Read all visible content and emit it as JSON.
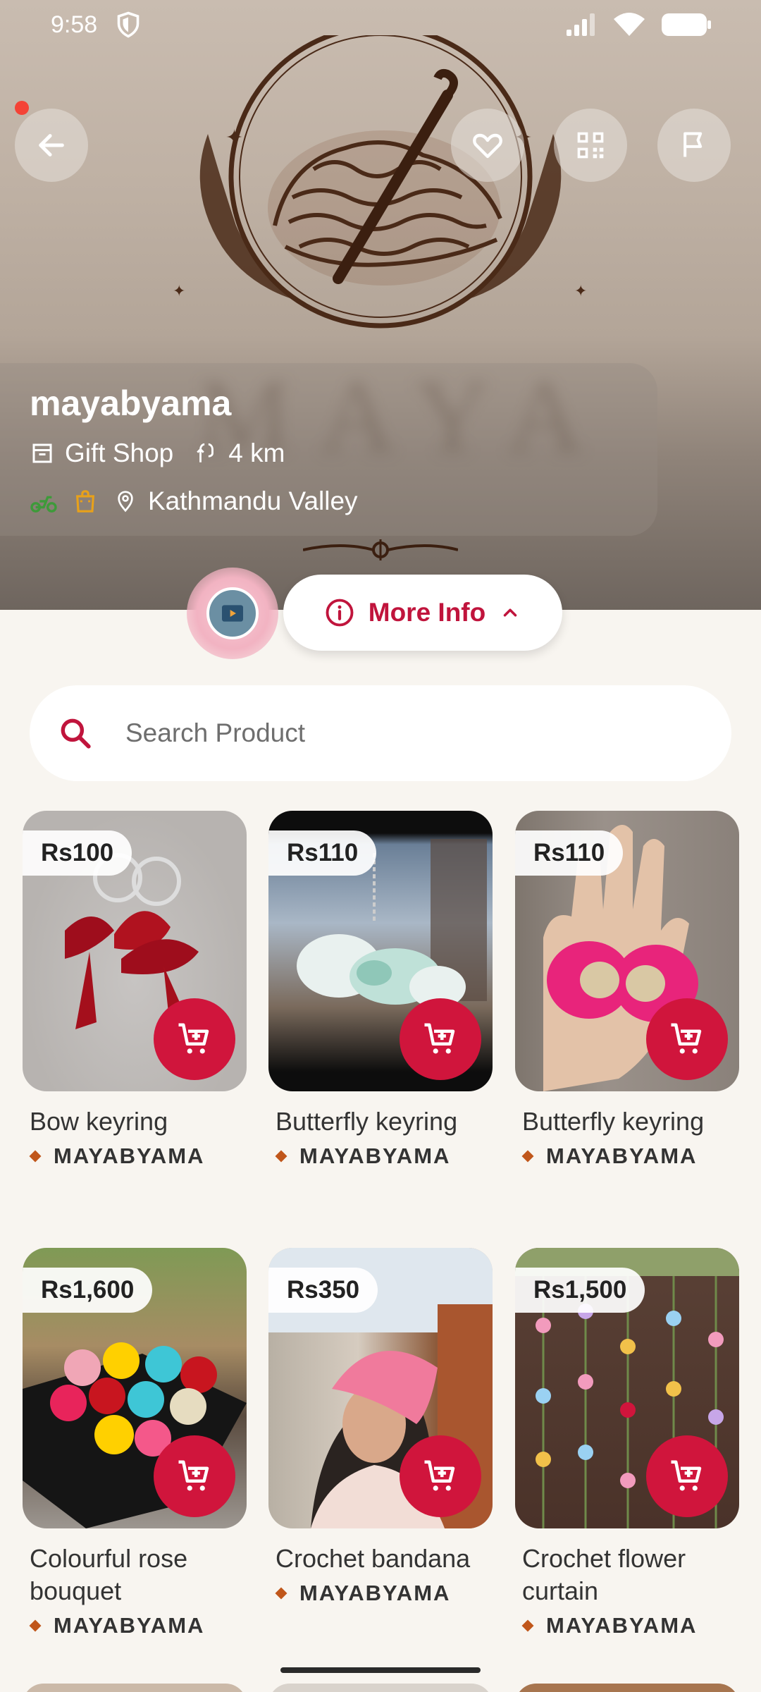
{
  "status_bar": {
    "time": "9:58"
  },
  "shop": {
    "name": "mayabyama",
    "category": "Gift Shop",
    "distance": "4 km",
    "location": "Kathmandu Valley"
  },
  "more_info": {
    "label": "More Info"
  },
  "search": {
    "placeholder": "Search Product"
  },
  "products": [
    {
      "price": "Rs100",
      "name": "Bow keyring",
      "shop": "MAYABYAMA"
    },
    {
      "price": "Rs110",
      "name": "Butterfly keyring",
      "shop": "MAYABYAMA"
    },
    {
      "price": "Rs110",
      "name": "Butterfly keyring",
      "shop": "MAYABYAMA"
    },
    {
      "price": "Rs1,600",
      "name": "Colourful rose bouquet",
      "shop": "MAYABYAMA"
    },
    {
      "price": "Rs350",
      "name": "Crochet bandana",
      "shop": "MAYABYAMA"
    },
    {
      "price": "Rs1,500",
      "name": "Crochet flower curtain",
      "shop": "MAYABYAMA"
    }
  ],
  "colors": {
    "accent": "#d0153c",
    "background": "#f8f5f0",
    "diamond": "#c0561a"
  },
  "icons": [
    "back-arrow-icon",
    "heart-icon",
    "qr-code-icon",
    "flag-icon",
    "store-icon",
    "route-icon",
    "delivery-scooter-icon",
    "shopping-bag-icon",
    "location-pin-icon",
    "info-icon",
    "chevron-up-icon",
    "search-icon",
    "add-to-cart-icon"
  ]
}
